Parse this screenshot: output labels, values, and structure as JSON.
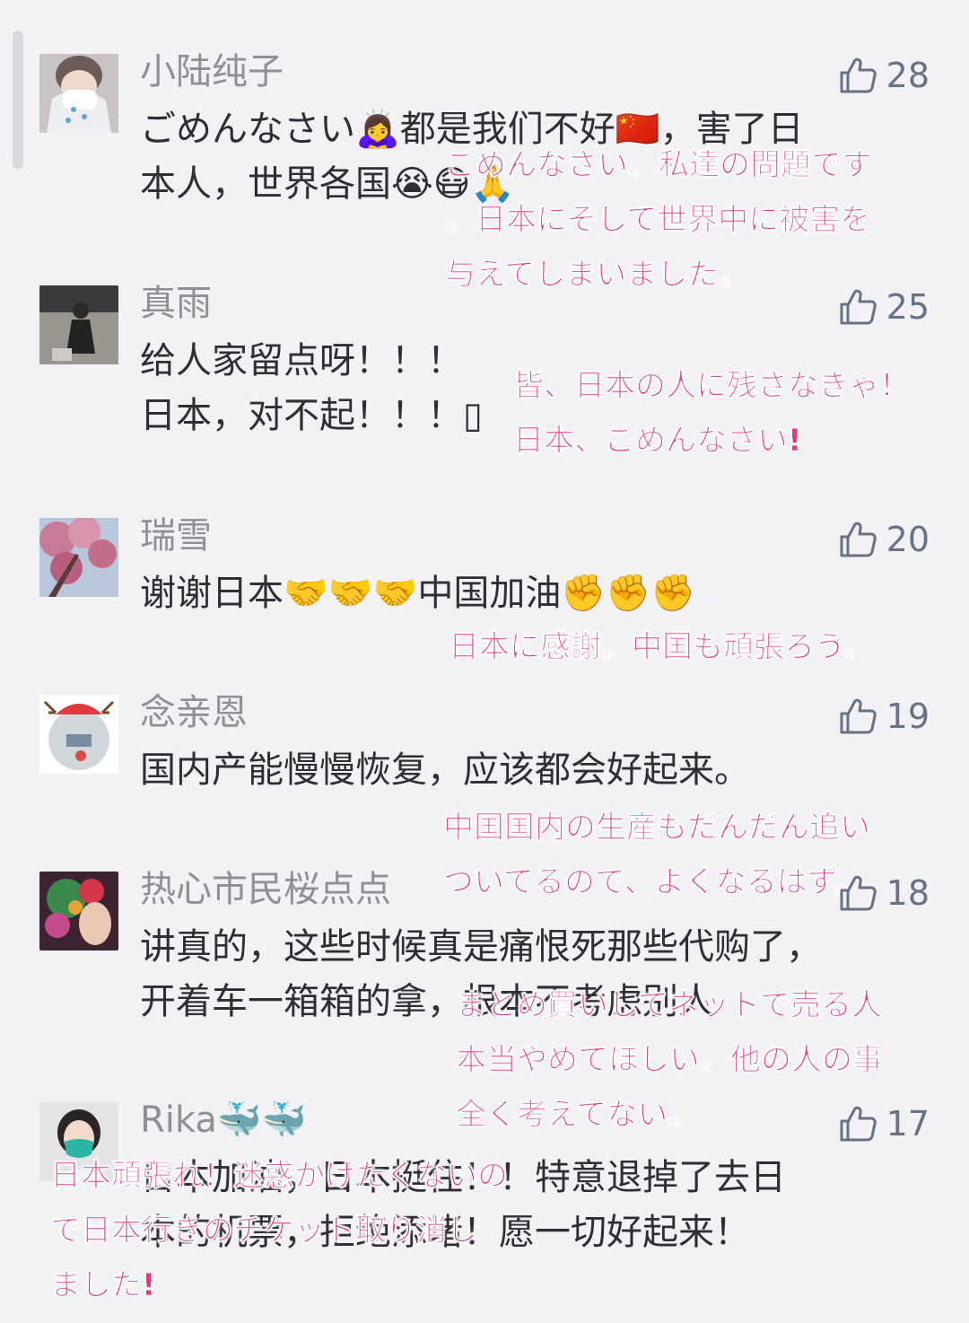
{
  "colors": {
    "background": "#f2f1f3",
    "username": "#8f8f95",
    "comment_text": "#2f2f33",
    "like": "#687287",
    "translation_overlay": "#e9337c"
  },
  "icons": {
    "like": "thumbs-up-outline-icon"
  },
  "comments": [
    {
      "name": "小陆纯子",
      "likes": "28",
      "avatar": "avatar-mask-photo",
      "lines": [
        "ごめんなさい🙇‍♀️都是我们不好🇨🇳，害了日",
        "本人，世界各国😭😷🙏"
      ],
      "translation": [
        "ごめんなさい。私達の問題です",
        "。日本にそして世界中に被害を",
        "与えてしまいました。"
      ]
    },
    {
      "name": "真雨",
      "likes": "25",
      "avatar": "avatar-person-photo",
      "lines": [
        "给人家留点呀！！！",
        "日本，对不起！！！▯"
      ],
      "translation": [
        "皆、日本の人に残さなきゃ！",
        "日本、ごめんなさい!"
      ]
    },
    {
      "name": "瑞雪",
      "likes": "20",
      "avatar": "avatar-blossom-photo",
      "lines": [
        "谢谢日本🤝🤝🤝中国加油✊✊✊"
      ],
      "translation": [
        "日本に感謝。中国も頑張ろう。"
      ]
    },
    {
      "name": "念亲恩",
      "likes": "19",
      "avatar": "avatar-christmas-photo",
      "lines": [
        "国内产能慢慢恢复，应该都会好起来。"
      ],
      "translation": [
        "中国国内の生産もだんだん追い",
        "ついてるので、よくなるはず。"
      ]
    },
    {
      "name": "热心市民桜点点",
      "likes": "18",
      "avatar": "avatar-flower-art",
      "lines": [
        "讲真的，这些时候真是痛恨死那些代购了，",
        "开着车一箱箱的拿，根本不考虑别人"
      ],
      "translation": [
        "まとめ買いしてネットで売る人",
        "本当やめてほしい。他の人の事",
        "全く考えてない。"
      ]
    },
    {
      "name": "Rika🐳🐳",
      "likes": "17",
      "avatar": "avatar-masked-woman",
      "lines": [
        "日本加油，日本挺住！！特意退掉了去日",
        "本的机票，拒绝添堵！愿一切好起来！"
      ],
      "translation": [
        "日本頑張れ！迷惑かけたくないの",
        "で日本行きのチケット取り消し",
        "ました!"
      ]
    }
  ]
}
